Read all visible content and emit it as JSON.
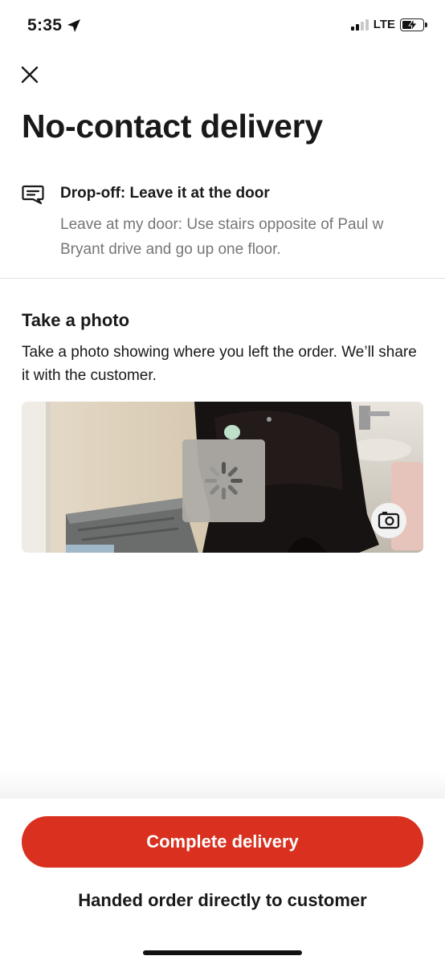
{
  "status_bar": {
    "time": "5:35",
    "network": "LTE",
    "icons": [
      "location-arrow-icon",
      "signal-icon",
      "battery-charging-icon"
    ]
  },
  "header": {
    "close_icon": "close-icon",
    "title": "No-contact delivery"
  },
  "dropoff": {
    "icon": "message-icon",
    "title": "Drop-off: Leave it at the door",
    "instructions": "Leave at my door: Use stairs opposite of Paul w Bryant drive and go up one floor."
  },
  "photo_section": {
    "heading": "Take a photo",
    "description": "Take a photo showing where you left the order. We’ll share it with the customer.",
    "loading_icon": "spinner-icon",
    "camera_icon": "camera-icon"
  },
  "actions": {
    "primary_label": "Complete delivery",
    "secondary_label": "Handed order directly to customer"
  },
  "colors": {
    "accent": "#d9301f",
    "text_primary": "#191919",
    "text_secondary": "#767676"
  }
}
